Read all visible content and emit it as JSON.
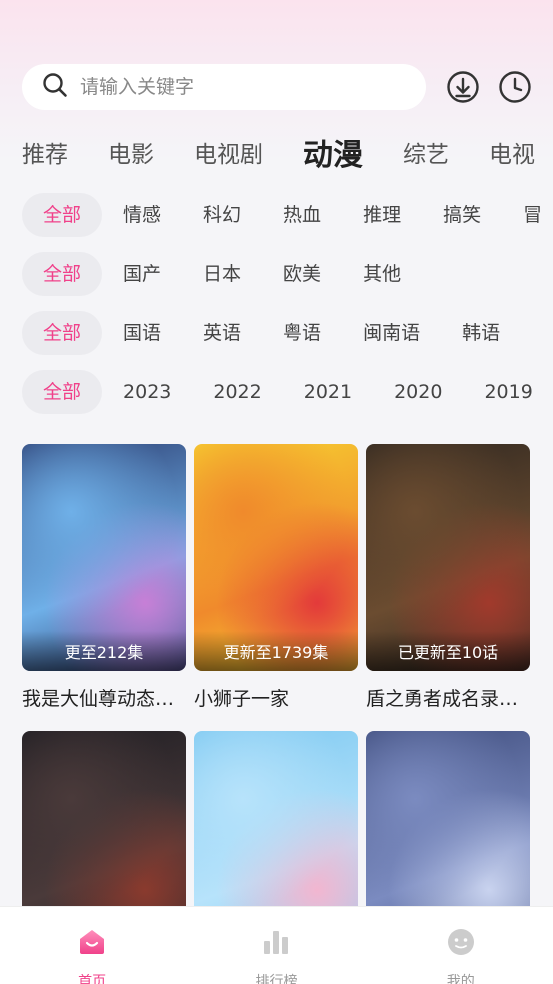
{
  "search": {
    "placeholder": "请输入关键字"
  },
  "header": {
    "download_icon": "download-icon",
    "history_icon": "clock-icon"
  },
  "categories": [
    "推荐",
    "电影",
    "电视剧",
    "动漫",
    "综艺",
    "电视"
  ],
  "active_category": "动漫",
  "filters": {
    "genre": {
      "options": [
        "全部",
        "情感",
        "科幻",
        "热血",
        "推理",
        "搞笑",
        "冒"
      ],
      "selected": "全部"
    },
    "region": {
      "options": [
        "全部",
        "国产",
        "日本",
        "欧美",
        "其他"
      ],
      "selected": "全部"
    },
    "language": {
      "options": [
        "全部",
        "国语",
        "英语",
        "粤语",
        "闽南语",
        "韩语"
      ],
      "selected": "全部"
    },
    "year": {
      "options": [
        "全部",
        "2023",
        "2022",
        "2021",
        "2020",
        "2019"
      ],
      "selected": "全部"
    }
  },
  "videos": [
    {
      "title": "我是大仙尊动态漫画",
      "badge": "更至212集",
      "colors": [
        "#2a3a6e",
        "#6fb0e8",
        "#c77fd6"
      ]
    },
    {
      "title": "小狮子一家",
      "badge": "更新至1739集",
      "colors": [
        "#f7d531",
        "#f08a2c",
        "#e33a3a"
      ]
    },
    {
      "title": "盾之勇者成名录第三季",
      "badge": "已更新至10话",
      "colors": [
        "#2d2620",
        "#6b4c30",
        "#a13a2c"
      ]
    },
    {
      "title": "",
      "badge": "",
      "colors": [
        "#1c1c22",
        "#4a3a3a",
        "#8a3a2e"
      ]
    },
    {
      "title": "",
      "badge": "",
      "colors": [
        "#7ac7f0",
        "#b7e3fb",
        "#f2b6d0"
      ]
    },
    {
      "title": "",
      "badge": "",
      "colors": [
        "#3c4a7a",
        "#7b8bc0",
        "#c9d3ef"
      ]
    }
  ],
  "tabbar": [
    {
      "label": "首页",
      "icon": "home-icon",
      "active": true
    },
    {
      "label": "排行榜",
      "icon": "chart-icon",
      "active": false
    },
    {
      "label": "我的",
      "icon": "profile-icon",
      "active": false
    }
  ],
  "colors": {
    "accent": "#f0418a",
    "chip_bg": "#ebebef"
  }
}
